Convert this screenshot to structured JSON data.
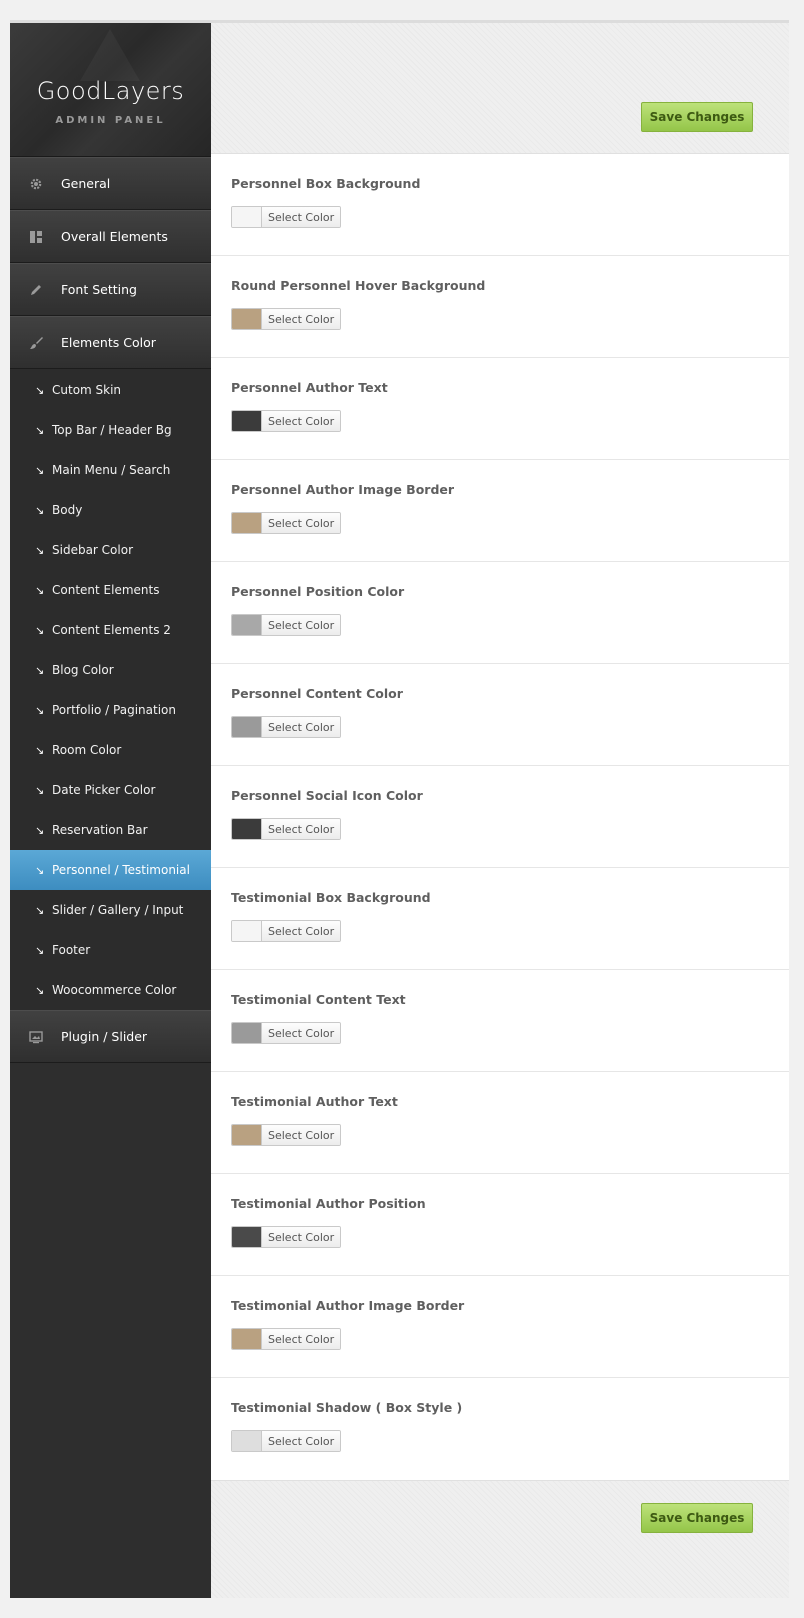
{
  "brand": {
    "title": "GoodLayers",
    "subtitle": "ADMIN PANEL"
  },
  "sidebar": {
    "top_items": [
      {
        "label": "General",
        "icon": "gear-icon"
      },
      {
        "label": "Overall Elements",
        "icon": "layout-icon"
      },
      {
        "label": "Font Setting",
        "icon": "pencil-icon"
      },
      {
        "label": "Elements Color",
        "icon": "brush-icon"
      }
    ],
    "sub_items": [
      {
        "label": "Cutom Skin"
      },
      {
        "label": "Top Bar / Header Bg"
      },
      {
        "label": "Main Menu / Search"
      },
      {
        "label": "Body"
      },
      {
        "label": "Sidebar Color"
      },
      {
        "label": "Content Elements"
      },
      {
        "label": "Content Elements 2"
      },
      {
        "label": "Blog Color"
      },
      {
        "label": "Portfolio / Pagination"
      },
      {
        "label": "Room Color"
      },
      {
        "label": "Date Picker Color"
      },
      {
        "label": "Reservation Bar"
      },
      {
        "label": "Personnel / Testimonial",
        "active": true
      },
      {
        "label": "Slider / Gallery / Input"
      },
      {
        "label": "Footer"
      },
      {
        "label": "Woocommerce Color"
      }
    ],
    "bottom_items": [
      {
        "label": "Plugin / Slider",
        "icon": "image-icon"
      }
    ]
  },
  "buttons": {
    "save_label": "Save Changes",
    "select_color_label": "Select Color"
  },
  "options": [
    {
      "label": "Personnel Box Background",
      "color": "#f5f5f5"
    },
    {
      "label": "Round Personnel Hover Background",
      "color": "#b9a181"
    },
    {
      "label": "Personnel Author Text",
      "color": "#3b3b3b"
    },
    {
      "label": "Personnel Author Image Border",
      "color": "#b9a181"
    },
    {
      "label": "Personnel Position Color",
      "color": "#a8a8a8"
    },
    {
      "label": "Personnel Content Color",
      "color": "#9a9a9a"
    },
    {
      "label": "Personnel Social Icon Color",
      "color": "#3b3b3b"
    },
    {
      "label": "Testimonial Box Background",
      "color": "#f5f5f5"
    },
    {
      "label": "Testimonial Content Text",
      "color": "#9a9a9a"
    },
    {
      "label": "Testimonial Author Text",
      "color": "#b9a181"
    },
    {
      "label": "Testimonial Author Position",
      "color": "#4a4a4a"
    },
    {
      "label": "Testimonial Author Image Border",
      "color": "#b9a181"
    },
    {
      "label": "Testimonial Shadow ( Box Style )",
      "color": "#dedede"
    }
  ]
}
